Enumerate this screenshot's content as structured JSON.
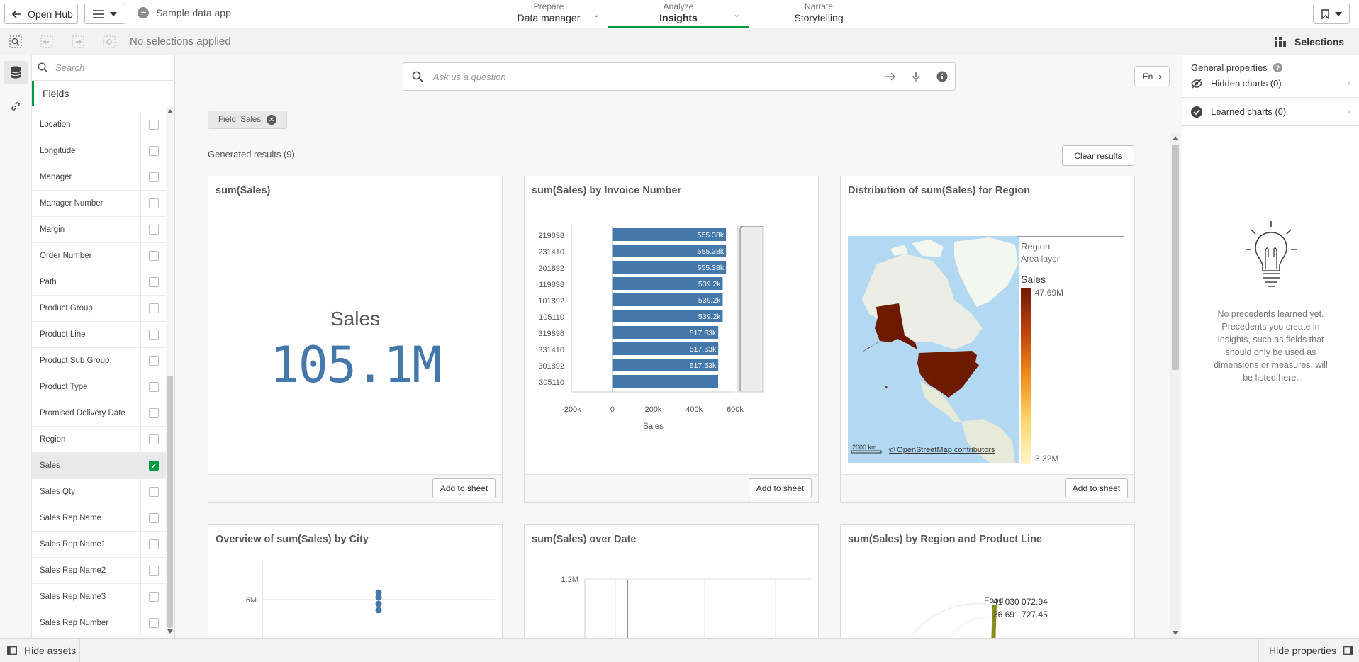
{
  "topbar": {
    "open_hub": "Open Hub",
    "app_name": "Sample data app",
    "app_icon": "•••",
    "tabs": [
      {
        "small": "Prepare",
        "label": "Data manager"
      },
      {
        "small": "Analyze",
        "label": "Insights"
      },
      {
        "small": "Narrate",
        "label": "Storytelling"
      }
    ]
  },
  "selbar": {
    "no_selections": "No selections applied",
    "selections": "Selections"
  },
  "assets": {
    "search_placeholder": "Search",
    "fields_header": "Fields",
    "fields": [
      {
        "name": "Location",
        "checked": false
      },
      {
        "name": "Longitude",
        "checked": false
      },
      {
        "name": "Manager",
        "checked": false
      },
      {
        "name": "Manager Number",
        "checked": false
      },
      {
        "name": "Margin",
        "checked": false
      },
      {
        "name": "Order Number",
        "checked": false
      },
      {
        "name": "Path",
        "checked": false
      },
      {
        "name": "Product Group",
        "checked": false
      },
      {
        "name": "Product Line",
        "checked": false
      },
      {
        "name": "Product Sub Group",
        "checked": false
      },
      {
        "name": "Product Type",
        "checked": false
      },
      {
        "name": "Promised Delivery Date",
        "checked": false
      },
      {
        "name": "Region",
        "checked": false
      },
      {
        "name": "Sales",
        "checked": true
      },
      {
        "name": "Sales Qty",
        "checked": false
      },
      {
        "name": "Sales Rep Name",
        "checked": false
      },
      {
        "name": "Sales Rep Name1",
        "checked": false
      },
      {
        "name": "Sales Rep Name2",
        "checked": false
      },
      {
        "name": "Sales Rep Name3",
        "checked": false
      },
      {
        "name": "Sales Rep Number",
        "checked": false
      }
    ]
  },
  "insights": {
    "ask_placeholder": "Ask us a question",
    "language": "En",
    "field_chip": "Field: Sales",
    "generated": "Generated results (9)",
    "clear_results": "Clear results",
    "add_to_sheet": "Add to sheet"
  },
  "cards": {
    "kpi": {
      "title": "sum(Sales)",
      "label": "Sales",
      "value": "105.1M"
    },
    "bar": {
      "title": "sum(Sales) by Invoice Number"
    },
    "map": {
      "title": "Distribution of sum(Sales) for Region",
      "legend_title": "Region",
      "legend_sub": "Area layer",
      "legend_measure": "Sales",
      "legend_max": "47.69M",
      "legend_min": "3.32M",
      "scale": "2000 km",
      "attribution": "© OpenStreetMap contributors",
      "colors": {
        "ocean": "#b3d9f2",
        "land": "#e8ecdf",
        "us": "#6e1a00"
      }
    },
    "city": {
      "title": "Overview of sum(Sales) by City",
      "ytick": "6M"
    },
    "date": {
      "title": "sum(Sales) over Date",
      "ytick": "1.2M"
    },
    "region_line": {
      "title": "sum(Sales) by Region and Product Line",
      "label1": "Food",
      "value1": "41 030 072.94",
      "value2": "36 691 727.45"
    }
  },
  "chart_data": [
    {
      "type": "bar",
      "orientation": "horizontal",
      "title": "sum(Sales) by Invoice Number",
      "xlabel": "Sales",
      "categories": [
        "219898",
        "231410",
        "201892",
        "119898",
        "101892",
        "105110",
        "319898",
        "331410",
        "301892",
        "305110"
      ],
      "values": [
        555380,
        555380,
        555380,
        539200,
        539200,
        539200,
        517630,
        517630,
        517630,
        517000
      ],
      "value_labels": [
        "555.38k",
        "555.38k",
        "555.38k",
        "539.2k",
        "539.2k",
        "539.2k",
        "517.63k",
        "517.63k",
        "517.63k",
        ""
      ],
      "xlim": [
        -200000,
        600000
      ],
      "xticks": [
        "-200k",
        "0",
        "200k",
        "400k",
        "600k"
      ],
      "color": "#4477aa"
    }
  ],
  "properties": {
    "header": "General properties",
    "hidden_charts": "Hidden charts (0)",
    "learned_charts": "Learned charts (0)",
    "empty_text": "No precedents learned yet. Precedents you create in Insights, such as fields that should only be used as dimensions or measures, will be listed here."
  },
  "bottombar": {
    "hide_assets": "Hide assets",
    "hide_properties": "Hide properties"
  },
  "colors": {
    "accent": "#009845",
    "chart_blue": "#4477aa"
  }
}
